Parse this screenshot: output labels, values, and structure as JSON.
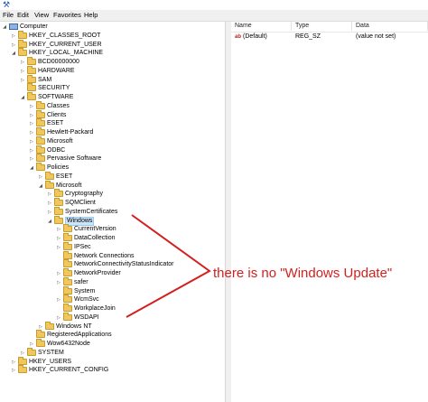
{
  "menu": [
    {
      "label": "File"
    },
    {
      "label": "Edit"
    },
    {
      "label": "View"
    },
    {
      "label": "Favorites"
    },
    {
      "label": "Help"
    }
  ],
  "tree": [
    {
      "label": "Computer",
      "icon": "computer",
      "expander": "down"
    },
    {
      "label": "HKEY_CLASSES_ROOT",
      "expander": "right"
    },
    {
      "label": "HKEY_CURRENT_USER",
      "expander": "right"
    },
    {
      "label": "HKEY_LOCAL_MACHINE",
      "expander": "down"
    },
    {
      "label": "BCD00000000",
      "expander": "right"
    },
    {
      "label": "HARDWARE",
      "expander": "right"
    },
    {
      "label": "SAM",
      "expander": "right"
    },
    {
      "label": "SECURITY",
      "expander": ""
    },
    {
      "label": "SOFTWARE",
      "expander": "down"
    },
    {
      "label": "Classes",
      "expander": "right"
    },
    {
      "label": "Clients",
      "expander": "right"
    },
    {
      "label": "ESET",
      "expander": "right"
    },
    {
      "label": "Hewlett-Packard",
      "expander": "right"
    },
    {
      "label": "Microsoft",
      "expander": "right"
    },
    {
      "label": "ODBC",
      "expander": "right"
    },
    {
      "label": "Pervasive Software",
      "expander": "right"
    },
    {
      "label": "Policies",
      "expander": "down"
    },
    {
      "label": "ESET",
      "expander": "right"
    },
    {
      "label": "Microsoft",
      "expander": "down"
    },
    {
      "label": "Cryptography",
      "expander": "right"
    },
    {
      "label": "SQMClient",
      "expander": "right"
    },
    {
      "label": "SystemCertificates",
      "expander": "right"
    },
    {
      "label": "Windows",
      "expander": "down",
      "selected": true
    },
    {
      "label": "CurrentVersion",
      "expander": "right"
    },
    {
      "label": "DataCollection",
      "expander": "right"
    },
    {
      "label": "IPSec",
      "expander": "right"
    },
    {
      "label": "Network Connections",
      "expander": ""
    },
    {
      "label": "NetworkConnectivityStatusIndicator",
      "expander": ""
    },
    {
      "label": "NetworkProvider",
      "expander": "right"
    },
    {
      "label": "safer",
      "expander": "right"
    },
    {
      "label": "System",
      "expander": ""
    },
    {
      "label": "WcmSvc",
      "expander": "right"
    },
    {
      "label": "WorkplaceJoin",
      "expander": ""
    },
    {
      "label": "WSDAPI",
      "expander": "right"
    },
    {
      "label": "Windows NT",
      "expander": "right"
    },
    {
      "label": "RegisteredApplications",
      "expander": ""
    },
    {
      "label": "Wow6432Node",
      "expander": "right"
    },
    {
      "label": "SYSTEM",
      "expander": "right"
    },
    {
      "label": "HKEY_USERS",
      "expander": "right"
    },
    {
      "label": "HKEY_CURRENT_CONFIG",
      "expander": "right"
    }
  ],
  "list": {
    "columns": [
      "Name",
      "Type",
      "Data"
    ],
    "rows": [
      {
        "name": "(Default)",
        "type": "REG_SZ",
        "data": "(value not set)",
        "icon": "ab"
      }
    ]
  },
  "annotation": {
    "text": "there is no \"Windows Update\"",
    "color": "#d41f1f"
  }
}
